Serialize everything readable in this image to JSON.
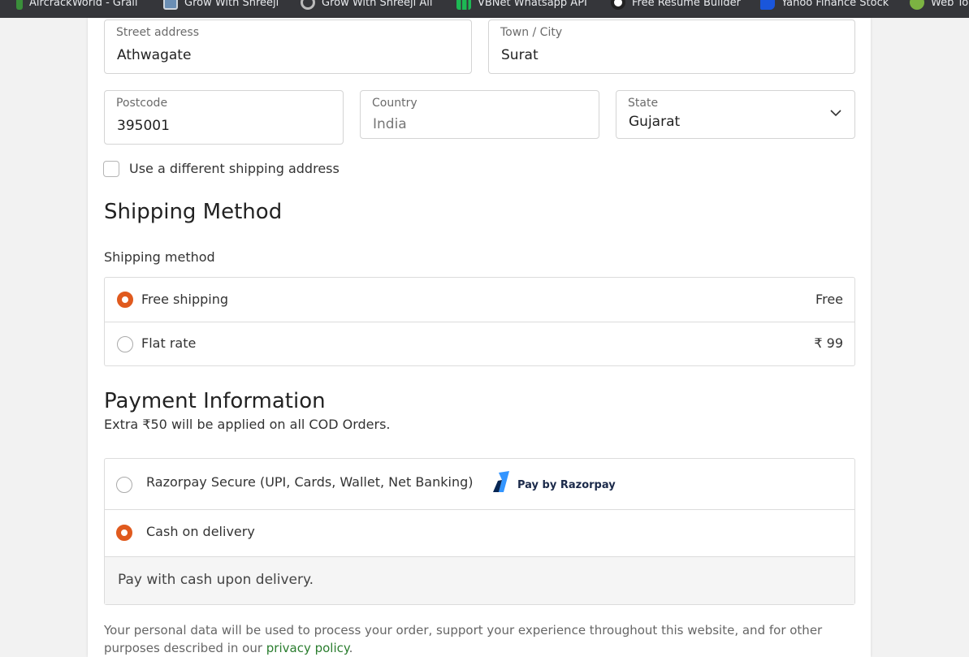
{
  "bookmarks": [
    {
      "label": "AircrackWorld - Grail",
      "icon": "green-leaf-icon"
    },
    {
      "label": "Grow With Shreeji",
      "icon": "framed-picture-icon"
    },
    {
      "label": "Grow With Shreeji All",
      "icon": "globe-icon"
    },
    {
      "label": "VBNet Whatsapp API",
      "icon": "green-bars-icon"
    },
    {
      "label": "Free Resume Builder",
      "icon": "dark-circle-icon"
    },
    {
      "label": "Yahoo Finance Stock",
      "icon": "blue-shape-icon"
    },
    {
      "label": "Web To",
      "icon": "green-circle-icon"
    }
  ],
  "address": {
    "street_label": "Street address",
    "street_value": "Athwagate",
    "city_label": "Town / City",
    "city_value": "Surat",
    "postcode_label": "Postcode",
    "postcode_value": "395001",
    "country_label": "Country",
    "country_value": "India",
    "state_label": "State",
    "state_value": "Gujarat"
  },
  "different_shipping_label": "Use a different shipping address",
  "shipping": {
    "heading": "Shipping Method",
    "sublabel": "Shipping method",
    "options": [
      {
        "label": "Free shipping",
        "price": "Free",
        "selected": true
      },
      {
        "label": "Flat rate",
        "price": "₹ 99",
        "selected": false
      }
    ]
  },
  "payment": {
    "heading": "Payment Information",
    "note": "Extra ₹50 will be applied on all COD Orders.",
    "options": [
      {
        "label": "Razorpay Secure (UPI, Cards, Wallet, Net Banking)",
        "badge": "Pay by Razorpay",
        "selected": false
      },
      {
        "label": "Cash on delivery",
        "selected": true
      }
    ],
    "cod_description": "Pay with cash upon delivery."
  },
  "privacy": {
    "text": "Your personal data will be used to process your order, support your experience throughout this website, and for other purposes described in our ",
    "link": "privacy policy",
    "end": "."
  },
  "colors": {
    "accent": "#e05a1e",
    "link": "#2a7d2e",
    "bookmarks_bar": "#35363a"
  }
}
